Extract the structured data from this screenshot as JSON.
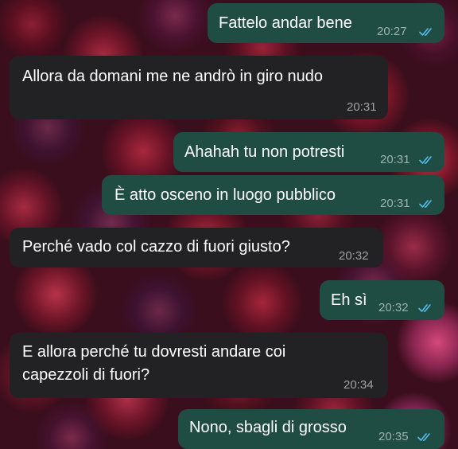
{
  "messages": [
    {
      "text": "Fattelo andar bene",
      "time": "20:27",
      "direction": "outgoing",
      "status": "read"
    },
    {
      "text": "Allora da domani me ne andrò in giro nudo",
      "time": "20:31",
      "direction": "incoming"
    },
    {
      "text": "Ahahah tu non potresti",
      "time": "20:31",
      "direction": "outgoing",
      "status": "read"
    },
    {
      "text": "È atto osceno in luogo pubblico",
      "time": "20:31",
      "direction": "outgoing",
      "status": "read"
    },
    {
      "text": "Perché vado col cazzo di fuori giusto?",
      "time": "20:32",
      "direction": "incoming"
    },
    {
      "text": "Eh sì",
      "time": "20:32",
      "direction": "outgoing",
      "status": "read"
    },
    {
      "lines": [
        "E allora perché tu dovresti andare coi",
        "capezzoli di fuori?"
      ],
      "time": "20:34",
      "direction": "incoming"
    },
    {
      "text": "Nono, sbagli di grosso",
      "time": "20:35",
      "direction": "outgoing",
      "status": "read"
    }
  ],
  "colors": {
    "outgoing_bubble": "#1f4d44",
    "incoming_bubble": "#222224",
    "read_ticks": "#53bdeb"
  },
  "icons": {
    "read_status": "double-check-icon"
  }
}
